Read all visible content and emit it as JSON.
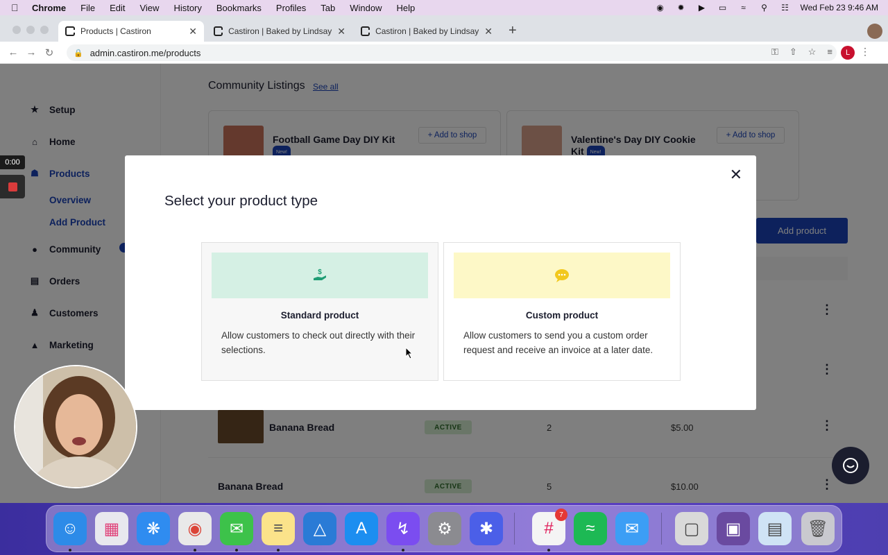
{
  "menubar": {
    "app": "Chrome",
    "items": [
      "File",
      "Edit",
      "View",
      "History",
      "Bookmarks",
      "Profiles",
      "Tab",
      "Window",
      "Help"
    ],
    "clock": "Wed Feb 23  9:46 AM"
  },
  "browser": {
    "tabs": [
      {
        "title": "Products | Castiron",
        "active": true
      },
      {
        "title": "Castiron | Baked by Lindsay",
        "active": false
      },
      {
        "title": "Castiron | Baked by Lindsay",
        "active": false
      }
    ],
    "url": "admin.castiron.me/products",
    "profile_initial": "L"
  },
  "sidebar": {
    "items": [
      {
        "label": "Setup",
        "icon": "star-icon"
      },
      {
        "label": "Home",
        "icon": "home-icon"
      },
      {
        "label": "Products",
        "icon": "products-icon"
      },
      {
        "label": "Community",
        "icon": "bulb-icon"
      },
      {
        "label": "Orders",
        "icon": "orders-icon"
      },
      {
        "label": "Customers",
        "icon": "customers-icon"
      },
      {
        "label": "Marketing",
        "icon": "megaphone-icon"
      }
    ],
    "sub_items": [
      "Overview",
      "Add Product"
    ]
  },
  "community": {
    "title": "Community Listings",
    "see_all": "See all",
    "listings": [
      {
        "name": "Football Game Day DIY Kit",
        "badge": "New!",
        "action": "+ Add to shop"
      },
      {
        "name": "Valentine's Day DIY Cookie Kit",
        "badge": "New!",
        "action": "+ Add to shop"
      }
    ]
  },
  "products": {
    "add_button": "Add product",
    "rows": [
      {
        "name": "Banana Bread",
        "status": "ACTIVE",
        "quantity": "2",
        "price": "$5.00"
      },
      {
        "name": "Banana Bread",
        "status": "ACTIVE",
        "quantity": "5",
        "price": "$10.00"
      }
    ]
  },
  "modal": {
    "title": "Select your product type",
    "options": [
      {
        "name": "Standard product",
        "description": "Allow customers to check out directly with their selections.",
        "icon": "hand-dollar-icon",
        "color": "#d5f0e4"
      },
      {
        "name": "Custom product",
        "description": "Allow customers to send you a custom order request and receive an invoice at a later date.",
        "icon": "chat-bubble-icon",
        "color": "#fdf8c7"
      }
    ]
  },
  "recording": {
    "timer": "0:00"
  },
  "dock": {
    "messages_badge": "7"
  }
}
